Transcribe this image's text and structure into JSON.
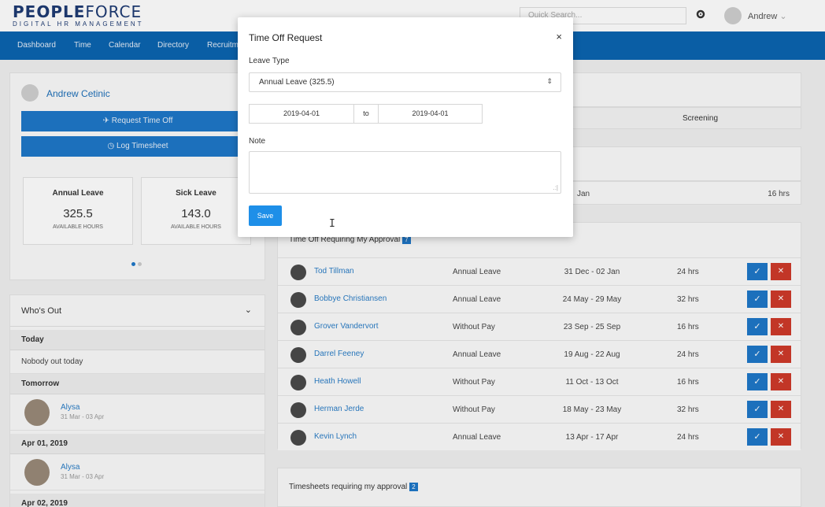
{
  "header": {
    "logo_main_bold": "PEOPLE",
    "logo_main_light": "FORCE",
    "logo_sub": "DIGITAL HR MANAGEMENT",
    "search_placeholder": "Quick Search...",
    "user_name": "Andrew",
    "gear_icon": "gear-icon",
    "user_caret": "⌄"
  },
  "nav": {
    "items": [
      {
        "label": "Dashboard"
      },
      {
        "label": "Time"
      },
      {
        "label": "Calendar"
      },
      {
        "label": "Directory"
      },
      {
        "label": "Recruitm"
      }
    ]
  },
  "profile": {
    "name": "Andrew Cetinic",
    "request_time_off": "✈ Request Time Off",
    "log_timesheet": "◷ Log Timesheet"
  },
  "balances": [
    {
      "title": "Annual Leave",
      "value": "325.5",
      "unit": "AVAILABLE HOURS"
    },
    {
      "title": "Sick Leave",
      "value": "143.0",
      "unit": "AVAILABLE HOURS"
    }
  ],
  "whos_out": {
    "title": "Who's Out",
    "caret": "⌄",
    "today_label": "Today",
    "today_text": "Nobody out today",
    "tomorrow_label": "Tomorrow",
    "tomorrow_person": {
      "name": "Alysa",
      "dates": "31 Mar - 03 Apr"
    },
    "apr01_label": "Apr 01, 2019",
    "apr01_person": {
      "name": "Alysa",
      "dates": "31 Mar - 03 Apr"
    },
    "apr02_label": "Apr 02, 2019"
  },
  "right": {
    "screening": "Screening",
    "jan": "Jan",
    "hrs": "16 hrs"
  },
  "approvals": {
    "title": "Time Off Requiring My Approval",
    "badge": "7",
    "rows": [
      {
        "name": "Tod Tillman",
        "type": "Annual Leave",
        "dates": "31 Dec - 02 Jan",
        "hours": "24 hrs"
      },
      {
        "name": "Bobbye Christiansen",
        "type": "Annual Leave",
        "dates": "24 May - 29 May",
        "hours": "32 hrs"
      },
      {
        "name": "Grover Vandervort",
        "type": "Without Pay",
        "dates": "23 Sep - 25 Sep",
        "hours": "16 hrs"
      },
      {
        "name": "Darrel Feeney",
        "type": "Annual Leave",
        "dates": "19 Aug - 22 Aug",
        "hours": "24 hrs"
      },
      {
        "name": "Heath Howell",
        "type": "Without Pay",
        "dates": "11 Oct - 13 Oct",
        "hours": "16 hrs"
      },
      {
        "name": "Herman Jerde",
        "type": "Without Pay",
        "dates": "18 May - 23 May",
        "hours": "32 hrs"
      },
      {
        "name": "Kevin Lynch",
        "type": "Annual Leave",
        "dates": "13 Apr - 17 Apr",
        "hours": "24 hrs"
      }
    ],
    "approve_glyph": "✓",
    "reject_glyph": "✕"
  },
  "timesheets": {
    "title": "Timesheets requiring my approval",
    "badge": "2"
  },
  "modal": {
    "title": "Time Off Request",
    "close": "×",
    "leave_type_label": "Leave Type",
    "leave_type_value": "Annual Leave (325.5)",
    "select_arrow": "⇕",
    "from_date": "2019-04-01",
    "to_label": "to",
    "to_date": "2019-04-01",
    "note_label": "Note",
    "note_value": "",
    "save_label": "Save",
    "resize_grip": ".:|",
    "cursor_glyph": "I"
  },
  "colors": {
    "nav": "#0b64b0",
    "primary": "#1e78c8",
    "reject": "#cf3a2a"
  }
}
